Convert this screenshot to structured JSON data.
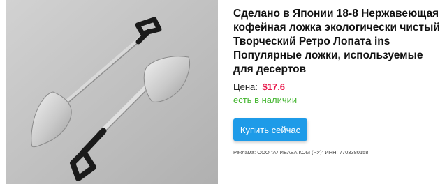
{
  "product": {
    "title": "Сделано в Японии 18-8 Нержавеющая\nкофейная ложка экологически чистый\nТворческий Ретро Лопата ins\nПопулярные ложки, используемые\nдля десертов",
    "image_icon": "shovel-spoons-photo"
  },
  "price": {
    "label": "Цена:",
    "value": "$17.6",
    "color": "#e8174a"
  },
  "stock": {
    "text": "есть в наличии",
    "color": "#43b52f"
  },
  "buy_button": {
    "label": "Купить сейчас",
    "color": "#1e9be8"
  },
  "ad_disclaimer": "Реклама: ООО \"АЛИБАБА.КОМ (РУ)\" ИНН: 7703380158"
}
